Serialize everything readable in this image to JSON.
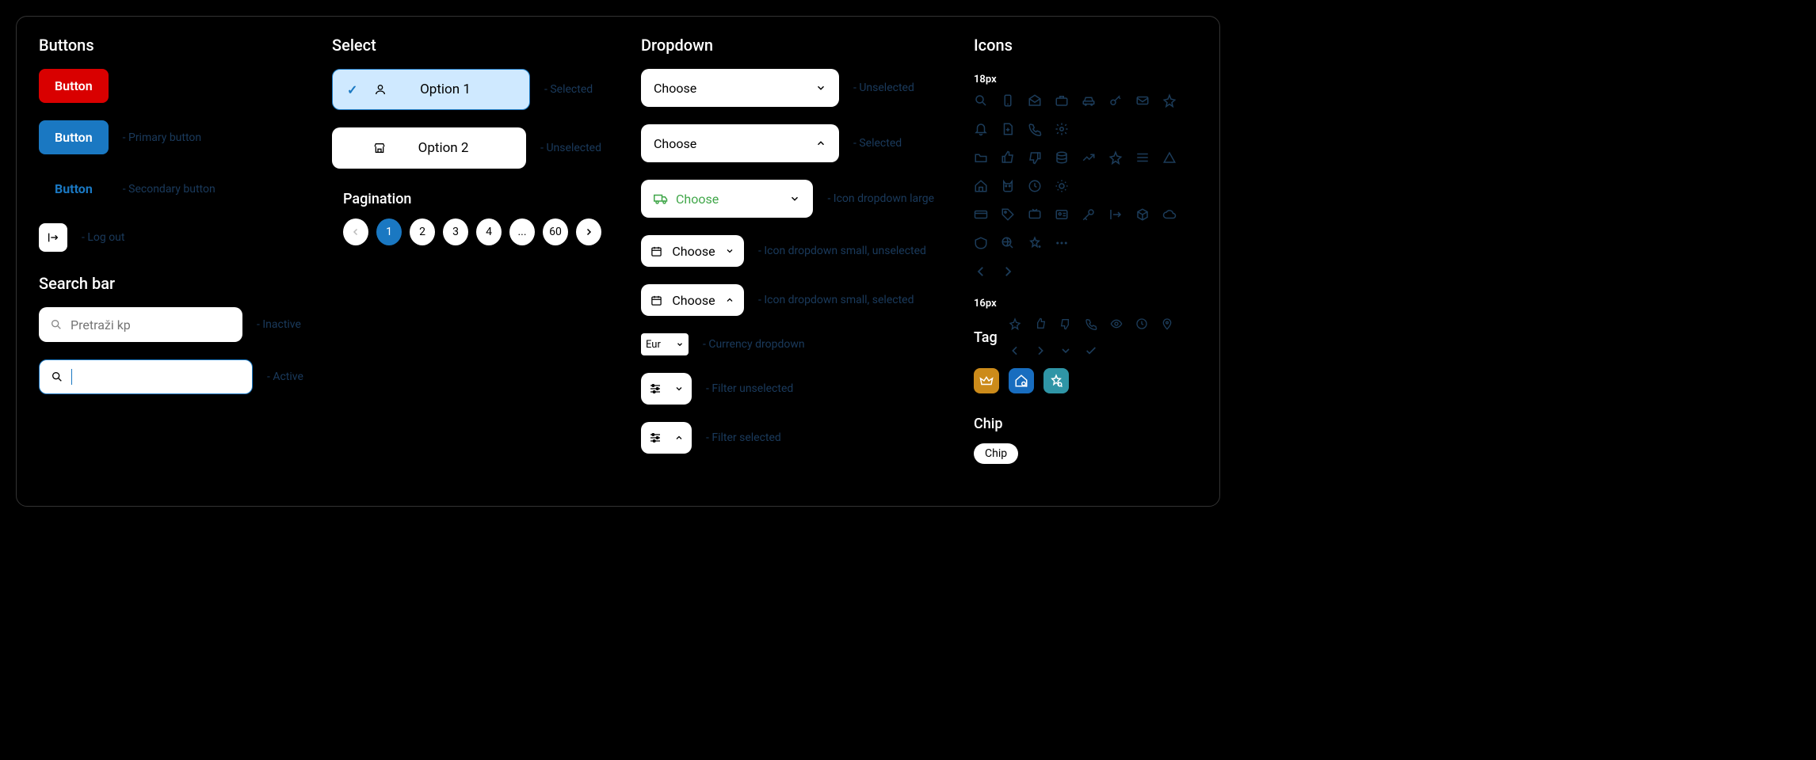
{
  "buttons": {
    "heading": "Buttons",
    "red_label": "Button",
    "blue_label": "Button",
    "blue_annot": "- Primary button",
    "ghost_label": "Button",
    "ghost_annot": "- Secondary button",
    "logout_annot": "- Log out"
  },
  "select": {
    "heading": "Select",
    "opt1": "Option 1",
    "opt1_annot": "- Selected",
    "opt2": "Option 2",
    "opt2_annot": "- Unselected"
  },
  "pagination": {
    "heading": "Pagination",
    "pages": [
      "1",
      "2",
      "3",
      "4",
      "...",
      "60"
    ]
  },
  "searchbar": {
    "heading": "Search bar",
    "placeholder": "Pretraži kp",
    "inactive_annot": "- Inactive",
    "active_annot": "- Active"
  },
  "dropdown": {
    "heading": "Dropdown",
    "choose": "Choose",
    "unselected_annot": "- Unselected",
    "selected_annot": "- Selected",
    "icon_lg_annot": "- Icon dropdown large",
    "icon_sm_un_annot": "- Icon dropdown small, unselected",
    "icon_sm_sel_annot": "- Icon dropdown small, selected",
    "currency": "Eur",
    "currency_annot": "- Currency dropdown",
    "filter_un_annot": "- Filter unselected",
    "filter_sel_annot": "- Filter selected"
  },
  "icons": {
    "heading": "Icons",
    "size18": "18px",
    "size16": "16px",
    "row1": [
      "search",
      "phone-mobile",
      "mail-open",
      "briefcase",
      "car",
      "key-alt",
      "mail",
      "star",
      "bell",
      "doc-add",
      "phone",
      "gear"
    ],
    "row2": [
      "folder",
      "thumbs-up",
      "thumbs-down",
      "database",
      "trend",
      "star-outline",
      "sliders",
      "triangle",
      "home",
      "cat",
      "clock-alt",
      "sun"
    ],
    "row3": [
      "card",
      "tag",
      "tv",
      "id",
      "key",
      "logout",
      "cube",
      "cloud",
      "badge",
      "globe-search",
      "star-search",
      "ellipsis"
    ],
    "row4": [
      "chevron-left",
      "chevron-right"
    ],
    "row16": [
      "star-sm",
      "thumbs-up-sm",
      "thumbs-down-sm",
      "phone-sm",
      "eye",
      "clock",
      "pin",
      "chevron-left-sm",
      "chevron-right-sm",
      "chevron-down-sm",
      "check-sm"
    ]
  },
  "tag": {
    "heading": "Tag"
  },
  "chip": {
    "heading": "Chip",
    "label": "Chip"
  },
  "colors": {
    "red": "#d90000",
    "blue": "#1a78c2",
    "green": "#3fa648",
    "gold": "#cc8b1a",
    "teal": "#2f95a6"
  }
}
